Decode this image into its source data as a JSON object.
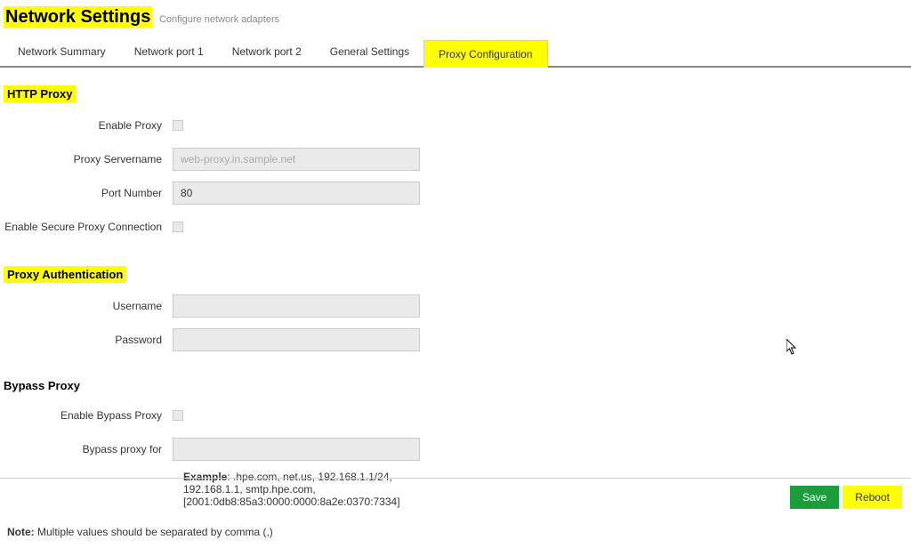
{
  "header": {
    "title": "Network Settings",
    "subtitle": "Configure network adapters"
  },
  "tabs": {
    "items": [
      {
        "label": "Network Summary"
      },
      {
        "label": "Network port 1"
      },
      {
        "label": "Network port 2"
      },
      {
        "label": "General Settings"
      },
      {
        "label": "Proxy Configuration"
      }
    ]
  },
  "sections": {
    "http_proxy": {
      "title": "HTTP Proxy",
      "enable_proxy_label": "Enable Proxy",
      "servername_label": "Proxy Servername",
      "servername_placeholder": "web-proxy.in.sample.net",
      "port_label": "Port Number",
      "port_value": "80",
      "secure_label": "Enable Secure Proxy Connection"
    },
    "auth": {
      "title": "Proxy Authentication",
      "username_label": "Username",
      "password_label": "Password"
    },
    "bypass": {
      "title": "Bypass Proxy",
      "enable_label": "Enable Bypass Proxy",
      "for_label": "Bypass proxy for",
      "example_label": "Example",
      "example_text": ": .hpe.com, net.us, 192.168.1.1/24, 192.168.1.1, smtp.hpe.com, [2001:0db8:85a3:0000:0000:8a2e:0370:7334]"
    }
  },
  "note": {
    "label": "Note:",
    "text": " Multiple values should be separated by comma (,)"
  },
  "footer": {
    "save": "Save",
    "reboot": "Reboot"
  }
}
